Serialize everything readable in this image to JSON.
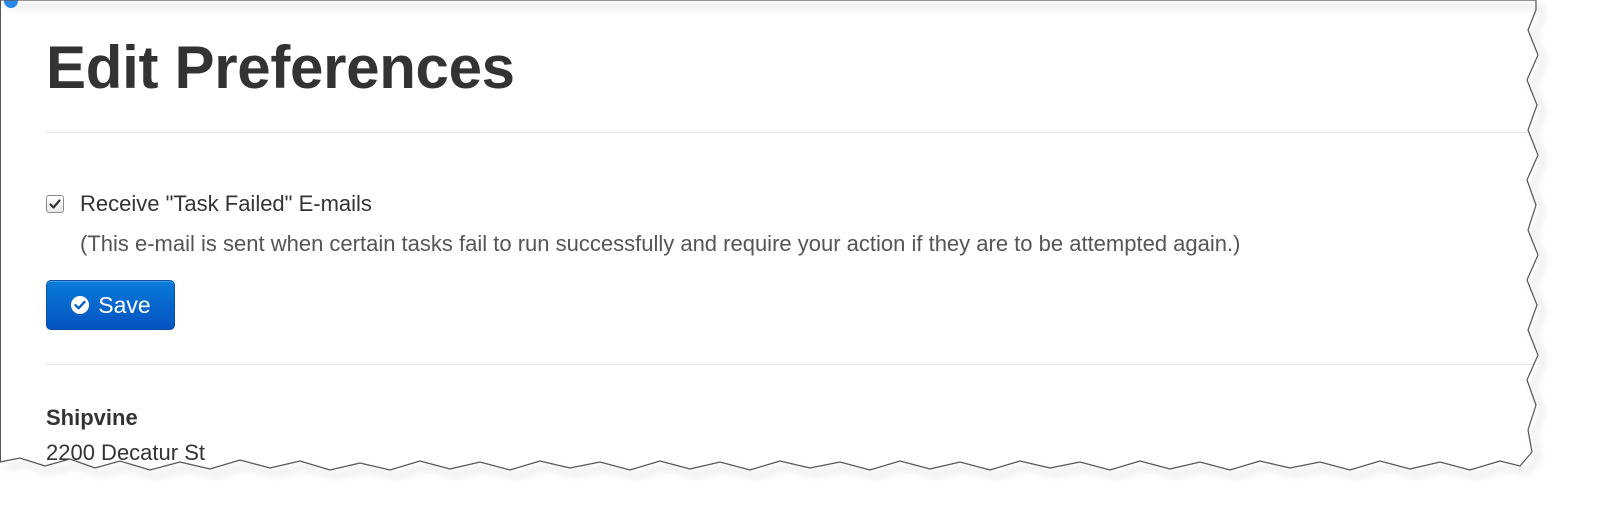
{
  "page": {
    "title": "Edit Preferences"
  },
  "preferences": {
    "task_failed": {
      "label": "Receive \"Task Failed\" E-mails",
      "checked": true,
      "note": "(This e-mail is sent when certain tasks fail to run successfully and require your action if they are to be attempted again.)"
    }
  },
  "actions": {
    "save_label": "Save",
    "save_icon": "check-circle-icon"
  },
  "footer": {
    "company_name": "Shipvine",
    "street": "2200 Decatur St"
  },
  "colors": {
    "primary_button": "#0563c9",
    "text": "#333333",
    "divider": "#e4e4e4"
  }
}
